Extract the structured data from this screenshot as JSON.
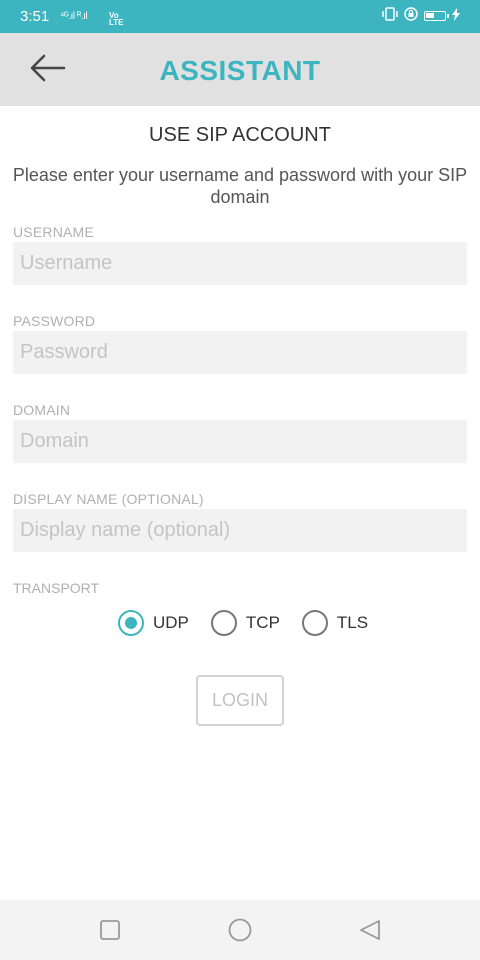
{
  "status_bar": {
    "time": "3:51",
    "signal_text": "⁴ᴳ.ıl ᴿ.ıl",
    "volte_text": "Vo\nLTE"
  },
  "app_bar": {
    "title": "ASSISTANT",
    "back_icon": "arrow-left-icon"
  },
  "content": {
    "section_title": "USE SIP ACCOUNT",
    "instructions": "Please enter your username and password with your SIP domain",
    "fields": [
      {
        "label": "USERNAME",
        "placeholder": "Username",
        "value": ""
      },
      {
        "label": "PASSWORD",
        "placeholder": "Password",
        "value": ""
      },
      {
        "label": "DOMAIN",
        "placeholder": "Domain",
        "value": ""
      },
      {
        "label": "DISPLAY NAME (OPTIONAL)",
        "placeholder": "Display name (optional)",
        "value": ""
      }
    ],
    "transport": {
      "label": "TRANSPORT",
      "options": [
        "UDP",
        "TCP",
        "TLS"
      ],
      "selected": "UDP"
    },
    "login_label": "LOGIN"
  },
  "nav_bar": {
    "icons": [
      "recents-square-icon",
      "home-circle-icon",
      "back-triangle-icon"
    ]
  },
  "colors": {
    "accent": "#3db5c0",
    "app_bar_bg": "#e1e1e1",
    "input_bg": "#f2f2f2"
  }
}
